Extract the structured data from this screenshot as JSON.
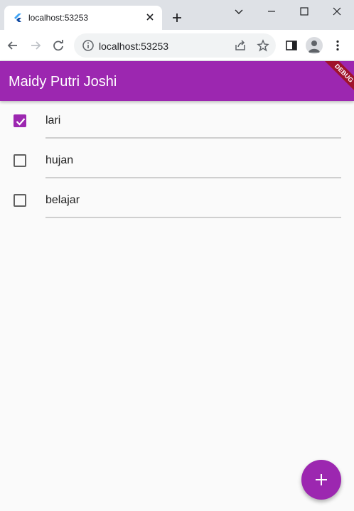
{
  "browser": {
    "tab_title": "localhost:53253",
    "address": "localhost:53253"
  },
  "app": {
    "title": "Maidy Putri Joshi",
    "debug_label": "DEBUG",
    "accent": "#9c27b0"
  },
  "todos": [
    {
      "text": "lari",
      "checked": true
    },
    {
      "text": "hujan",
      "checked": false
    },
    {
      "text": "belajar",
      "checked": false
    }
  ]
}
